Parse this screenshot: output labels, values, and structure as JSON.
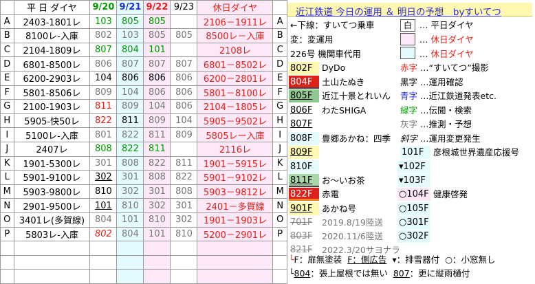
{
  "header": {
    "weekday_label": "平 日 ダイヤ",
    "dates": [
      "9/20",
      "9/21",
      "9/22",
      "9/23"
    ],
    "holiday_label": "休日ダイヤ"
  },
  "rows": [
    {
      "key": "A",
      "weekday": "2403-1801レ",
      "d1": "103",
      "d2": "805",
      "d3": "805",
      "d4": "",
      "holiday": "2106－1911レ"
    },
    {
      "key": "B",
      "weekday": "8100レ-入庫",
      "d1": "802",
      "d2": "103",
      "d3": "805",
      "d4": "805",
      "holiday": "8500レ－入庫"
    },
    {
      "key": "C",
      "weekday": "2104-1809レ",
      "d1": "807",
      "d2": "804",
      "d3": "101",
      "d4": "",
      "holiday": "2108レ"
    },
    {
      "key": "D",
      "weekday": "6801-8500レ",
      "d1": "806",
      "d2": "807",
      "d3": "807",
      "d4": "807",
      "holiday": "6801－8502レ"
    },
    {
      "key": "E",
      "weekday": "6200-2903レ",
      "d1": "104",
      "d2": "806",
      "d3": "806",
      "d4": "806",
      "holiday": "6200－2801レ"
    },
    {
      "key": "F",
      "weekday": "5801-8506レ",
      "d1": "809",
      "d2": "104",
      "d3": "806",
      "d4": "806",
      "holiday": "5801－8100レ"
    },
    {
      "key": "G",
      "weekday": "2100-1903レ",
      "d1": "811",
      "d2": "809",
      "d3": "104",
      "d4": "806",
      "holiday": "2104－1805レ"
    },
    {
      "key": "H",
      "weekday": "5905-快50レ",
      "d1": "822",
      "d2": "811",
      "d3": "809",
      "d4": "104",
      "holiday": "5905－9502レ"
    },
    {
      "key": "I",
      "weekday": "5100レ-入庫",
      "d1": "801",
      "d2": "822",
      "d3": "811",
      "d4": "809",
      "holiday": "5805レー入庫"
    },
    {
      "key": "J",
      "weekday": "2407レ",
      "d1": "808",
      "d2": "822",
      "d3": "811",
      "d4": "",
      "holiday": "2116レ"
    },
    {
      "key": "K",
      "weekday": "1901-5300レ",
      "d1": "301",
      "d2": "808",
      "d3": "822",
      "d4": "811",
      "holiday": "1901－5915レ"
    },
    {
      "key": "L",
      "weekday": "5901-9100レ",
      "d1": "302",
      "d2": "301",
      "d3": "808",
      "d4": "822",
      "holiday": "5901－9102レ"
    },
    {
      "key": "M",
      "weekday": "5903-9800レ",
      "d1": "810",
      "d2": "302",
      "d3": "301",
      "d4": "808",
      "holiday": "5903－9812レ"
    },
    {
      "key": "N",
      "weekday": "2901-9500レ",
      "d1": "101",
      "d2": "810",
      "d3": "302",
      "d4": "301",
      "holiday": "2401－多賀線"
    },
    {
      "key": "O",
      "weekday": "3401レ(多賀線)",
      "d1": "804",
      "d2": "101",
      "d3": "810",
      "d4": "302",
      "holiday": "1901－1903レ"
    },
    {
      "key": "P",
      "weekday": "5803レ-入庫",
      "d1": "802",
      "d2": "804",
      "d3": "101",
      "d4": "810",
      "holiday": "5200－2901レ"
    }
  ],
  "panel": {
    "title": "近江鉄道 今日の運用 ＆ 明日の予想　byすいてつ",
    "legend": {
      "underline_key": "←下線：すいてつ乗車",
      "henkou": "変：変運用",
      "daiyou": "226号 機関車代用",
      "box_white": "白",
      "weekday_dia": "平日ダイヤ",
      "holiday_dia": "休日ダイヤ",
      "holiday_dia2": "休日ダイヤ",
      "dots": "…",
      "akaji": "赤字",
      "akaji_desc": "“すいてつ”撮影",
      "kuroji": "黒字",
      "kuroji_desc": "運用確認",
      "aoji": "青字",
      "aoji_desc": "近江鉄道発表etc.",
      "midori": "緑字",
      "midori_desc": "伝聞・検索",
      "haiji": "灰字",
      "haiji_desc": "推測・予想",
      "shaji": "斜字",
      "shaji_desc": "運用変更発生",
      "hikone": "彦根城世界遺産応援号",
      "kenko": "健康啓発"
    },
    "cars": [
      {
        "id": "802F",
        "desc": "DyDo"
      },
      {
        "id": "804F",
        "desc": "土山たぬき"
      },
      {
        "id": "805F",
        "desc": "近江十景とれいん"
      },
      {
        "id": "806F",
        "desc": "わたSHIGA"
      },
      {
        "id": "807F",
        "desc": ""
      },
      {
        "id": "808F",
        "desc": "豊郷あかね：四季"
      },
      {
        "id": "809F",
        "desc": ""
      },
      {
        "id": "810F",
        "desc": ""
      },
      {
        "id": "811F",
        "desc": "お～いお茶"
      },
      {
        "id": "822F",
        "desc": "赤電"
      },
      {
        "id": "901F",
        "desc": "あかね号"
      },
      {
        "id": "701F",
        "desc": "2019.8/19陸送"
      },
      {
        "id": "803F",
        "desc": "2020.11/6陸送"
      },
      {
        "id": "821F",
        "desc": "2022.3/20サヨナラ"
      }
    ],
    "cars2": [
      "101F",
      "102F",
      "103F",
      "104F",
      "105F",
      "301F",
      "302F"
    ],
    "footnote1": "F：扉無塗装",
    "footnote1b": "F：側広告",
    "footnote1c": "：排雪器付",
    "footnote1d": "：小窓無し",
    "footnote2a": "804",
    "footnote2b": "：張上屋根では無い",
    "footnote2c": "807",
    "footnote2d": "：更に縦雨樋付"
  },
  "colors": {
    "green": "#009900",
    "blue": "#1a2fd6",
    "red": "#e0201b",
    "gray": "#777777",
    "title_bg": "#fff8b0"
  }
}
